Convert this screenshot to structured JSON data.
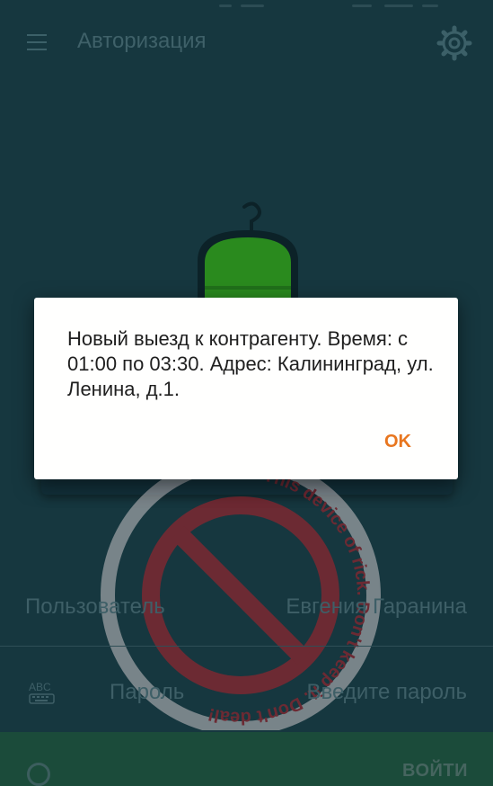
{
  "appbar": {
    "title": "Авторизация"
  },
  "watermark": {
    "text": "This device of rick. Don't keep it. Don't deal!"
  },
  "form": {
    "user_label": "Пользователь",
    "user_value": "Евгения Гаранина",
    "password_label": "Пароль",
    "password_placeholder": "Введите пароль",
    "keyboard_icon_label": "ABC"
  },
  "login": {
    "label": "ВОЙТИ"
  },
  "dialog": {
    "message": "Новый выезд к контрагенту. Время: с 01:00 по 03:30. Адрес: Калининград, ул. Ленина, д.1.",
    "ok_label": "OK"
  },
  "colors": {
    "background": "#16373f",
    "dialog_accent": "#e8761f",
    "logo_green": "#2a8a1e",
    "stamp_red": "#b3202a"
  }
}
